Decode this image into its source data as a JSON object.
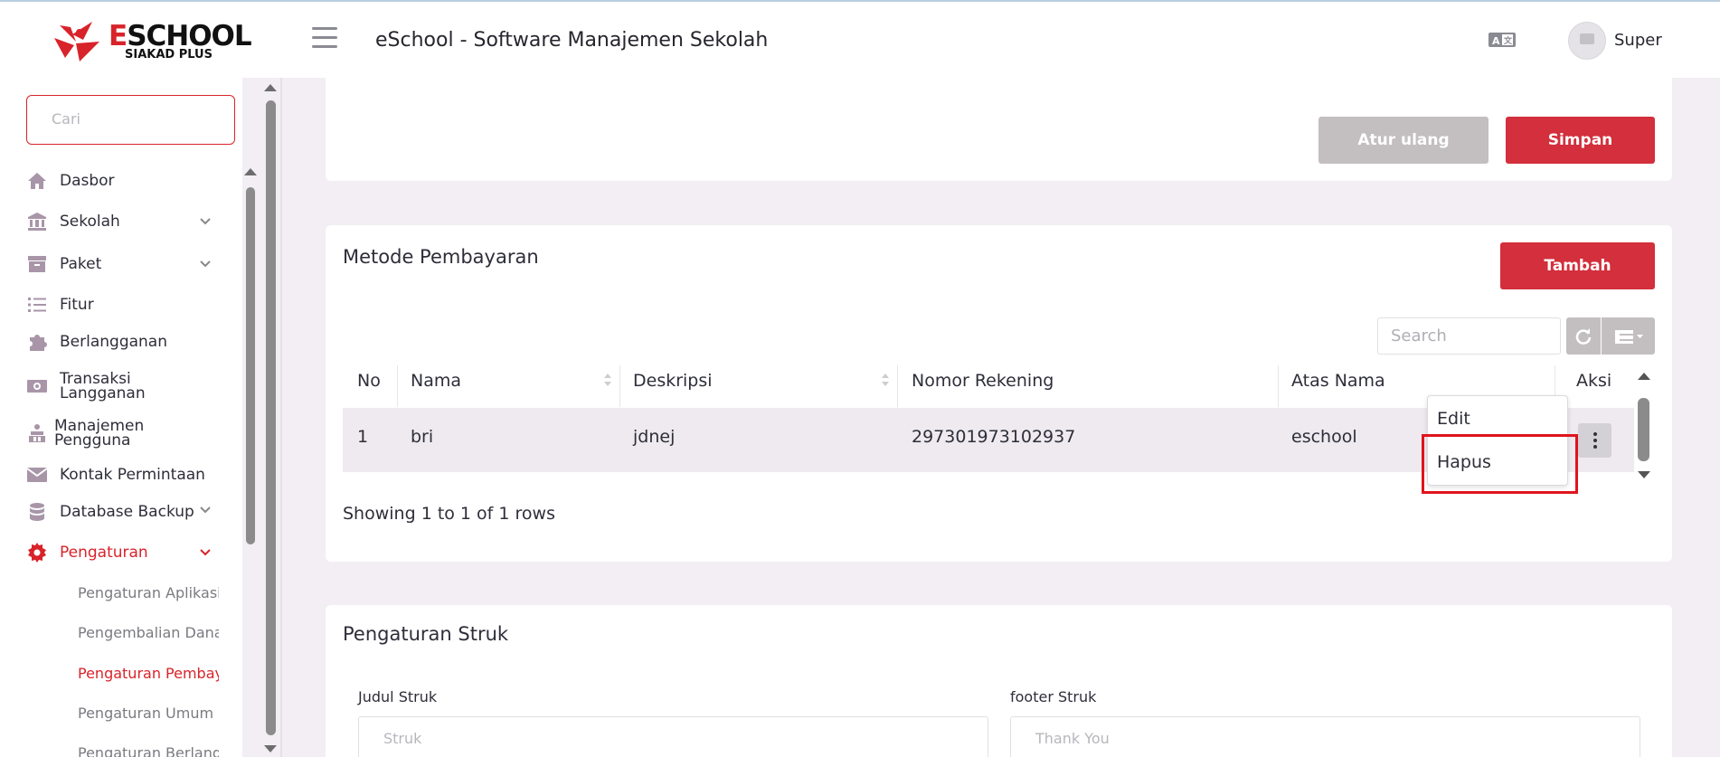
{
  "header": {
    "logo_name": "ESCHOOL",
    "logo_sub": "SIAKAD PLUS",
    "app_title": "eSchool - Software Manajemen Sekolah",
    "user_name": "Super",
    "icons": [
      "hamburger-icon",
      "language-icon",
      "avatar"
    ]
  },
  "sidebar": {
    "search_placeholder": "Cari",
    "items": [
      {
        "label": "Dasbor",
        "icon": "home-icon"
      },
      {
        "label": "Sekolah",
        "icon": "school-icon",
        "has_chevron": true
      },
      {
        "label": "Paket",
        "icon": "package-icon",
        "has_chevron": true
      },
      {
        "label": "Fitur",
        "icon": "list-icon"
      },
      {
        "label": "Berlangganan",
        "icon": "puzzle-icon"
      },
      {
        "label": "Transaksi Langganan",
        "icon": "money-icon"
      },
      {
        "label": "Manajemen Pengguna",
        "icon": "users-icon",
        "has_chevron": true
      },
      {
        "label": "Kontak Permintaan",
        "icon": "envelope-icon"
      },
      {
        "label": "Database Backup",
        "icon": "database-icon"
      },
      {
        "label": "Pengaturan",
        "icon": "gear-icon",
        "has_chevron": true,
        "active": true
      }
    ],
    "sub_items": [
      {
        "label": "Pengaturan Aplikasi"
      },
      {
        "label": "Pengembalian Dana"
      },
      {
        "label": "Pengaturan Pembayaran",
        "active": true
      },
      {
        "label": "Pengaturan Umum"
      },
      {
        "label": "Pengaturan Berlangganan"
      }
    ]
  },
  "top_card": {
    "reset_label": "Atur ulang",
    "save_label": "Simpan"
  },
  "payment_card": {
    "title": "Metode Pembayaran",
    "add_label": "Tambah",
    "search_placeholder": "Search",
    "columns": [
      "No",
      "Nama",
      "Deskripsi",
      "Nomor Rekening",
      "Atas Nama",
      "Aksi"
    ],
    "rows": [
      {
        "no": "1",
        "nama": "bri",
        "deskripsi": "jdnej",
        "nomor_rekening": "297301973102937",
        "atas_nama": "eschool"
      }
    ],
    "dropdown": {
      "edit": "Edit",
      "delete": "Hapus"
    },
    "footer": "Showing 1 to 1 of 1 rows"
  },
  "receipt_card": {
    "title": "Pengaturan Struk",
    "title_label": "Judul Struk",
    "title_placeholder": "Struk",
    "footer_label": "footer Struk",
    "footer_placeholder": "Thank You"
  },
  "colors": {
    "accent": "#d32f3c",
    "background": "#f2eef4",
    "muted_button": "#c3bfc1",
    "highlight": "#e0141c"
  }
}
